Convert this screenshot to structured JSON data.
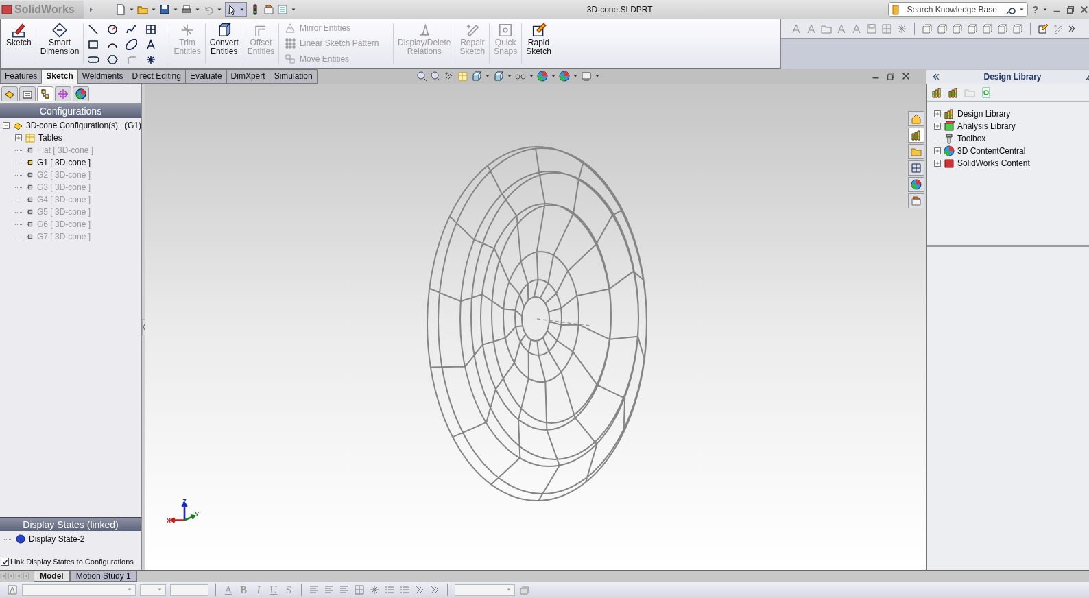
{
  "app": {
    "logo": "SolidWorks",
    "title": "3D-cone.SLDPRT",
    "search": {
      "placeholder": "Search Knowledge Base"
    },
    "help": "?"
  },
  "ribbon": [
    {
      "kind": "button",
      "label": "Sketch",
      "disabled": false
    },
    {
      "kind": "button",
      "label": "Smart Dimension",
      "disabled": false
    },
    {
      "kind": "tools"
    },
    {
      "kind": "button",
      "label": "Trim Entities",
      "disabled": true
    },
    {
      "kind": "button",
      "label": "Convert Entities",
      "disabled": false
    },
    {
      "kind": "button",
      "label": "Offset Entities",
      "disabled": true
    },
    {
      "kind": "list",
      "items": [
        {
          "label": "Mirror Entities",
          "disabled": true
        },
        {
          "label": "Linear Sketch Pattern",
          "disabled": true
        },
        {
          "label": "Move Entities",
          "disabled": true
        }
      ]
    },
    {
      "kind": "button",
      "label": "Display/Delete Relations",
      "disabled": true
    },
    {
      "kind": "button",
      "label": "Repair Sketch",
      "disabled": true
    },
    {
      "kind": "button",
      "label": "Quick Snaps",
      "disabled": true
    },
    {
      "kind": "button",
      "label": "Rapid Sketch",
      "disabled": false
    }
  ],
  "tabs": [
    {
      "label": "Features",
      "selected": false
    },
    {
      "label": "Sketch",
      "selected": true
    },
    {
      "label": "Weldments",
      "selected": false
    },
    {
      "label": "Direct Editing",
      "selected": false
    },
    {
      "label": "Evaluate",
      "selected": false
    },
    {
      "label": "DimXpert",
      "selected": false
    },
    {
      "label": "Simulation",
      "selected": false
    }
  ],
  "left_panel": {
    "tabs": [
      {
        "kind": "feature",
        "selected": false
      },
      {
        "kind": "property",
        "selected": false
      },
      {
        "kind": "configuration",
        "selected": true
      },
      {
        "kind": "dimxpert",
        "selected": false
      },
      {
        "kind": "display",
        "selected": false
      }
    ],
    "header": "Configurations",
    "tree": {
      "label": "3D-cone Configuration(s)",
      "active_name": "(G1)",
      "expanded": true,
      "children": [
        {
          "kind": "table",
          "label": "Tables",
          "expanded": false
        },
        {
          "kind": "config",
          "label": "Flat [ 3D-cone ]",
          "active": false
        },
        {
          "kind": "config",
          "label": "G1 [ 3D-cone ]",
          "active": true
        },
        {
          "kind": "config",
          "label": "G2 [ 3D-cone ]",
          "active": false
        },
        {
          "kind": "config",
          "label": "G3 [ 3D-cone ]",
          "active": false
        },
        {
          "kind": "config",
          "label": "G4 [ 3D-cone ]",
          "active": false
        },
        {
          "kind": "config",
          "label": "G5 [ 3D-cone ]",
          "active": false
        },
        {
          "kind": "config",
          "label": "G6 [ 3D-cone ]",
          "active": false
        },
        {
          "kind": "config",
          "label": "G7 [ 3D-cone ]",
          "active": false
        }
      ]
    },
    "display_header": "Display States (linked)",
    "display_state": "Display State-2",
    "link_checkbox": {
      "label": "Link Display States to Configurations",
      "checked": true
    }
  },
  "triad": {
    "x": "X",
    "y": "Y",
    "z": "Z"
  },
  "task_pane_tabs": [
    {
      "kind": "home",
      "selected": false
    },
    {
      "kind": "library",
      "selected": true
    },
    {
      "kind": "folder",
      "selected": false
    },
    {
      "kind": "view",
      "selected": false
    },
    {
      "kind": "appearance",
      "selected": false
    },
    {
      "kind": "custom",
      "selected": false
    }
  ],
  "design_library": {
    "title": "Design Library",
    "items": [
      {
        "label": "Design Library",
        "kind": "library",
        "expandable": true
      },
      {
        "label": "Analysis Library",
        "kind": "analysis",
        "expandable": true
      },
      {
        "label": "Toolbox",
        "kind": "toolbox",
        "expandable": false
      },
      {
        "label": "3D ContentCentral",
        "kind": "globe",
        "expandable": true
      },
      {
        "label": "SolidWorks Content",
        "kind": "sw",
        "expandable": true
      }
    ]
  },
  "bottom_tabs": [
    {
      "label": "Model",
      "selected": true
    },
    {
      "label": "Motion Study 1",
      "selected": false
    }
  ],
  "format_buttons": [
    {
      "label": "A",
      "kind": "color"
    },
    {
      "label": "B",
      "kind": "bold"
    },
    {
      "label": "I",
      "kind": "italic"
    },
    {
      "label": "U",
      "kind": "underline"
    },
    {
      "label": "S",
      "kind": "strike"
    }
  ]
}
